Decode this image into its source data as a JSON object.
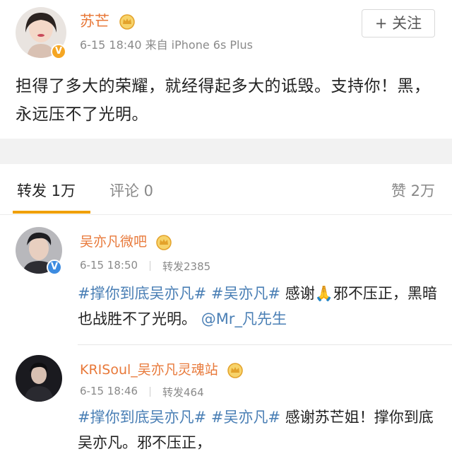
{
  "post": {
    "author": "苏芒",
    "meta": "6-15 18:40   来自 iPhone 6s Plus",
    "follow_label": "+ 关注",
    "body": "担得了多大的荣耀，就经得起多大的诋毁。支持你！黑，永远压不了光明。"
  },
  "tabs": {
    "repost": "转发 1万",
    "comment": "评论 0",
    "like": "赞 2万"
  },
  "reposts": [
    {
      "author": "吴亦凡微吧",
      "time": "6-15 18:50",
      "count": "转发2385",
      "tag1": "#撑你到底吴亦凡#",
      "tag2": "#吴亦凡#",
      "text_a": " 感谢🙏邪不压正，黑暗也战胜不了光明。",
      "mention": "@Mr_凡先生"
    },
    {
      "author": "KRISoul_吴亦凡灵魂站",
      "time": "6-15 18:46",
      "count": "转发464",
      "tag1": "#撑你到底吴亦凡#",
      "tag2": "#吴亦凡#",
      "text_a": " 感谢苏芒姐！撑你到底吴亦凡。邪不压正，"
    }
  ],
  "colors": {
    "name": "#e8793a",
    "link": "#4a7fb5",
    "accent": "#f0a000",
    "gap": "#f2f2f2"
  }
}
